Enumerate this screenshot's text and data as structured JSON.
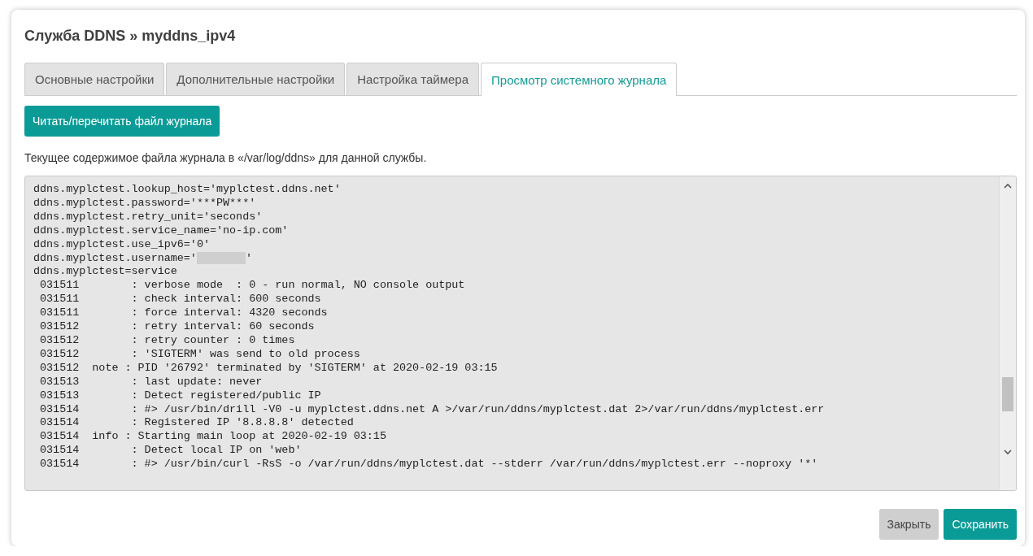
{
  "title": "Служба DDNS » myddns_ipv4",
  "tabs": [
    {
      "label": "Основные настройки",
      "selected": false
    },
    {
      "label": "Дополнительные настройки",
      "selected": false
    },
    {
      "label": "Настройка таймера",
      "selected": false
    },
    {
      "label": "Просмотр системного журнала",
      "selected": true
    }
  ],
  "read_button": "Читать/перечитать файл журнала",
  "description": "Текущее содержимое файла журнала в «/var/log/ddns» для данной службы.",
  "log_lines": [
    {
      "text": "ddns.myplctest.lookup_host='myplctest.ddns.net'",
      "redacted": false
    },
    {
      "text": "ddns.myplctest.password='***PW***'",
      "redacted": false
    },
    {
      "text": "ddns.myplctest.retry_unit='seconds'",
      "redacted": false
    },
    {
      "text": "ddns.myplctest.service_name='no-ip.com'",
      "redacted": false
    },
    {
      "text": "ddns.myplctest.use_ipv6='0'",
      "redacted": false
    },
    {
      "text": "ddns.myplctest.username='",
      "redacted": true,
      "tail": "'"
    },
    {
      "text": "ddns.myplctest=service",
      "redacted": false
    },
    {
      "text": " 031511        : verbose mode  : 0 - run normal, NO console output",
      "redacted": false
    },
    {
      "text": " 031511        : check interval: 600 seconds",
      "redacted": false
    },
    {
      "text": " 031511        : force interval: 4320 seconds",
      "redacted": false
    },
    {
      "text": " 031512        : retry interval: 60 seconds",
      "redacted": false
    },
    {
      "text": " 031512        : retry counter : 0 times",
      "redacted": false
    },
    {
      "text": " 031512        : 'SIGTERM' was send to old process",
      "redacted": false
    },
    {
      "text": " 031512  note : PID '26792' terminated by 'SIGTERM' at 2020-02-19 03:15",
      "redacted": false
    },
    {
      "text": " 031513        : last update: never",
      "redacted": false
    },
    {
      "text": " 031513        : Detect registered/public IP",
      "redacted": false
    },
    {
      "text": " 031514        : #> /usr/bin/drill -V0 -u myplctest.ddns.net A >/var/run/ddns/myplctest.dat 2>/var/run/ddns/myplctest.err",
      "redacted": false
    },
    {
      "text": " 031514        : Registered IP '8.8.8.8' detected",
      "redacted": false
    },
    {
      "text": " 031514  info : Starting main loop at 2020-02-19 03:15",
      "redacted": false
    },
    {
      "text": " 031514        : Detect local IP on 'web'",
      "redacted": false
    },
    {
      "text": " 031514        : #> /usr/bin/curl -RsS -o /var/run/ddns/myplctest.dat --stderr /var/run/ddns/myplctest.err --noproxy '*'",
      "redacted": false
    }
  ],
  "footer_buttons": [
    {
      "label": "Закрыть",
      "kind": "secondary"
    },
    {
      "label": "Сохранить",
      "kind": "primary"
    }
  ]
}
